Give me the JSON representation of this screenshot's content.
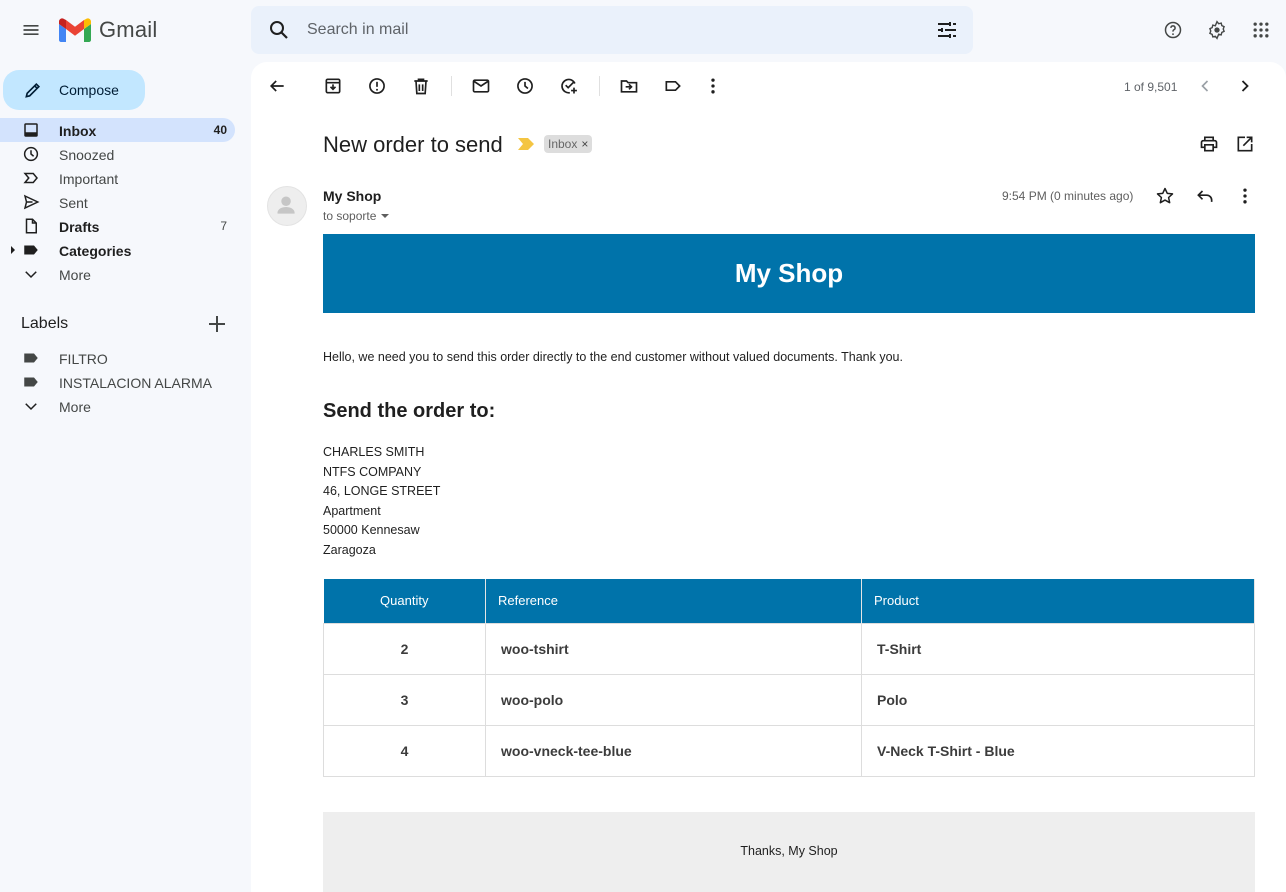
{
  "app": {
    "name": "Gmail",
    "brand_colors": {
      "red": "#ea4335",
      "blue": "#4285f4",
      "green": "#34a853",
      "yellow": "#fbbc04"
    }
  },
  "header": {
    "menu_icon": "hamburger-menu-icon",
    "search": {
      "placeholder": "Search in mail",
      "value": ""
    },
    "icons": [
      "help-icon",
      "settings-gear-icon",
      "apps-grid-icon"
    ]
  },
  "sidebar": {
    "compose_label": "Compose",
    "nav": [
      {
        "label": "Inbox",
        "icon": "inbox-icon",
        "count": "40",
        "active": true,
        "bold": true
      },
      {
        "label": "Snoozed",
        "icon": "clock-icon",
        "count": ""
      },
      {
        "label": "Important",
        "icon": "important-icon",
        "count": ""
      },
      {
        "label": "Sent",
        "icon": "send-icon",
        "count": ""
      },
      {
        "label": "Drafts",
        "icon": "draft-icon",
        "count": "7",
        "bold": true
      },
      {
        "label": "Categories",
        "icon": "label-icon",
        "count": "",
        "bold": true,
        "expandable": true
      },
      {
        "label": "More",
        "icon": "chevron-down-icon",
        "count": ""
      }
    ],
    "labels_title": "Labels",
    "labels": [
      {
        "label": "FILTRO",
        "icon": "label-icon"
      },
      {
        "label": "INSTALACION ALARMA",
        "icon": "label-icon"
      },
      {
        "label": "More",
        "icon": "chevron-down-icon"
      }
    ]
  },
  "toolbar": {
    "pager": "1 of 9,501",
    "buttons": [
      "back",
      "archive",
      "report-spam",
      "delete",
      "mark-unread",
      "snooze",
      "add-to-tasks",
      "move-to",
      "labels",
      "more"
    ]
  },
  "message": {
    "subject": "New order to send",
    "chip_label": "Inbox",
    "chip_close": "×",
    "sender": "My Shop",
    "recipient": "to soporte",
    "time": "9:54 PM (0 minutes ago)"
  },
  "email": {
    "banner_title": "My Shop",
    "banner_color": "#0073aa",
    "intro": "Hello, we need you to send this order directly to the end customer without valued documents. Thank you.",
    "heading": "Send the order to:",
    "address": [
      "CHARLES SMITH",
      "NTFS COMPANY",
      "46, LONGE STREET",
      "Apartment",
      "50000 Kennesaw",
      "Zaragoza"
    ],
    "table": {
      "headers": [
        "Quantity",
        "Reference",
        "Product"
      ],
      "rows": [
        [
          "2",
          "woo-tshirt",
          "T-Shirt"
        ],
        [
          "3",
          "woo-polo",
          "Polo"
        ],
        [
          "4",
          "woo-vneck-tee-blue",
          "V-Neck T-Shirt - Blue"
        ]
      ]
    },
    "footer": "Thanks, My Shop"
  }
}
